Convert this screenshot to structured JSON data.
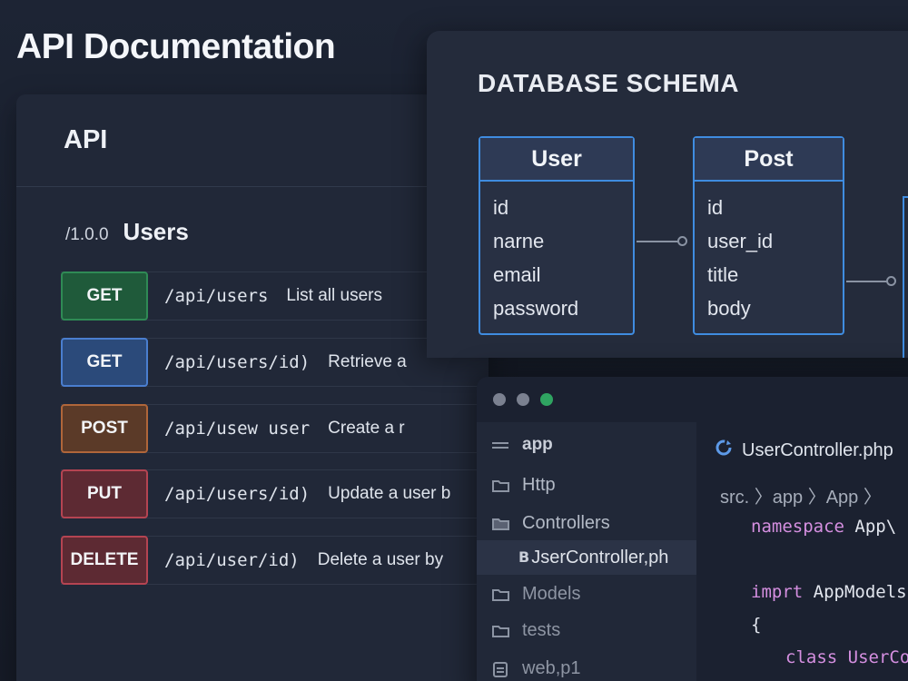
{
  "page": {
    "title": "API Documentation"
  },
  "api": {
    "header": "API",
    "version": "/1.0.0",
    "section": "Users",
    "endpoints": [
      {
        "method": "GET",
        "path": "/api/users",
        "description": "List all users"
      },
      {
        "method": "GET",
        "path": "/api/users/id)",
        "description": "Retrieve a"
      },
      {
        "method": "POST",
        "path": "/api/usew user",
        "description": "Create a r"
      },
      {
        "method": "PUT",
        "path": "/api/users/id)",
        "description": "Update a user b"
      },
      {
        "method": "DELETE",
        "path": "/api/user/id)",
        "description": "Delete a user by"
      }
    ]
  },
  "schema": {
    "title": "DATABASE SCHEMA",
    "tables": [
      {
        "name": "User",
        "fields": [
          "id",
          "narne",
          "email",
          "password"
        ]
      },
      {
        "name": "Post",
        "fields": [
          "id",
          "user_id",
          "title",
          "body"
        ]
      }
    ]
  },
  "editor": {
    "tree": {
      "root": "app",
      "items": [
        "Http",
        "Controllers",
        "JserController,ph",
        "Models",
        "tests",
        "web,p1"
      ]
    },
    "tab": "UserController.php",
    "breadcrumb": "src. 〉app 〉App 〉",
    "code": {
      "line1_kw": "namespace",
      "line1_rest": " App\\",
      "line2_kw": "imprt",
      "line2_rest": " AppModels",
      "line3": "{",
      "line4_kw": "class",
      "line4_rest": " UserCo"
    }
  },
  "colors": {
    "get_green": "#2f8a55",
    "get_blue": "#4a7ecf",
    "post_orange": "#b0663a",
    "put_delete_red": "#b54452",
    "schema_blue": "#3f8ce0",
    "window_green": "#2fa461"
  }
}
